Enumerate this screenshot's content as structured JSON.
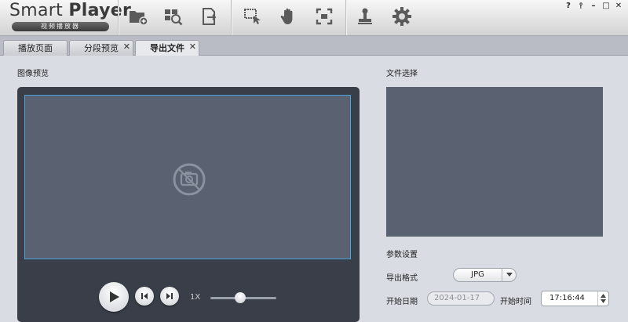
{
  "app": {
    "title_light": "Smart ",
    "title_bold": "Player",
    "subtitle": "视频播放器"
  },
  "toolbar": {
    "items": [
      {
        "icon": "add-folder-icon"
      },
      {
        "icon": "search-window-icon"
      },
      {
        "icon": "export-file-icon"
      },
      {
        "icon": "select-cursor-icon"
      },
      {
        "icon": "hand-icon"
      },
      {
        "icon": "fullscreen-icon"
      },
      {
        "icon": "stamp-icon"
      },
      {
        "icon": "gear-icon"
      }
    ]
  },
  "window_controls": {
    "help": "?",
    "pin": "⫯",
    "minimize": "–",
    "maximize": "□",
    "close": "✕"
  },
  "tabs": [
    {
      "label": "播放页面",
      "closable": false,
      "active": false
    },
    {
      "label": "分段预览",
      "closable": true,
      "active": false
    },
    {
      "label": "导出文件",
      "closable": true,
      "active": true
    }
  ],
  "tab_close_glyph": "✕",
  "preview": {
    "label": "图像预览",
    "speed": "1X",
    "speed_slider_fraction": 0.45
  },
  "file_select": {
    "label": "文件选择"
  },
  "params": {
    "label": "参数设置",
    "format_label": "导出格式",
    "format_value": "JPG",
    "start_date_label": "开始日期",
    "start_date_value": "2024-01-17",
    "start_time_label": "开始时间",
    "start_time_value": "17:16:44"
  },
  "colors": {
    "accent": "#4aa3df",
    "panel": "#3a3e49",
    "screen": "#5a6272"
  }
}
